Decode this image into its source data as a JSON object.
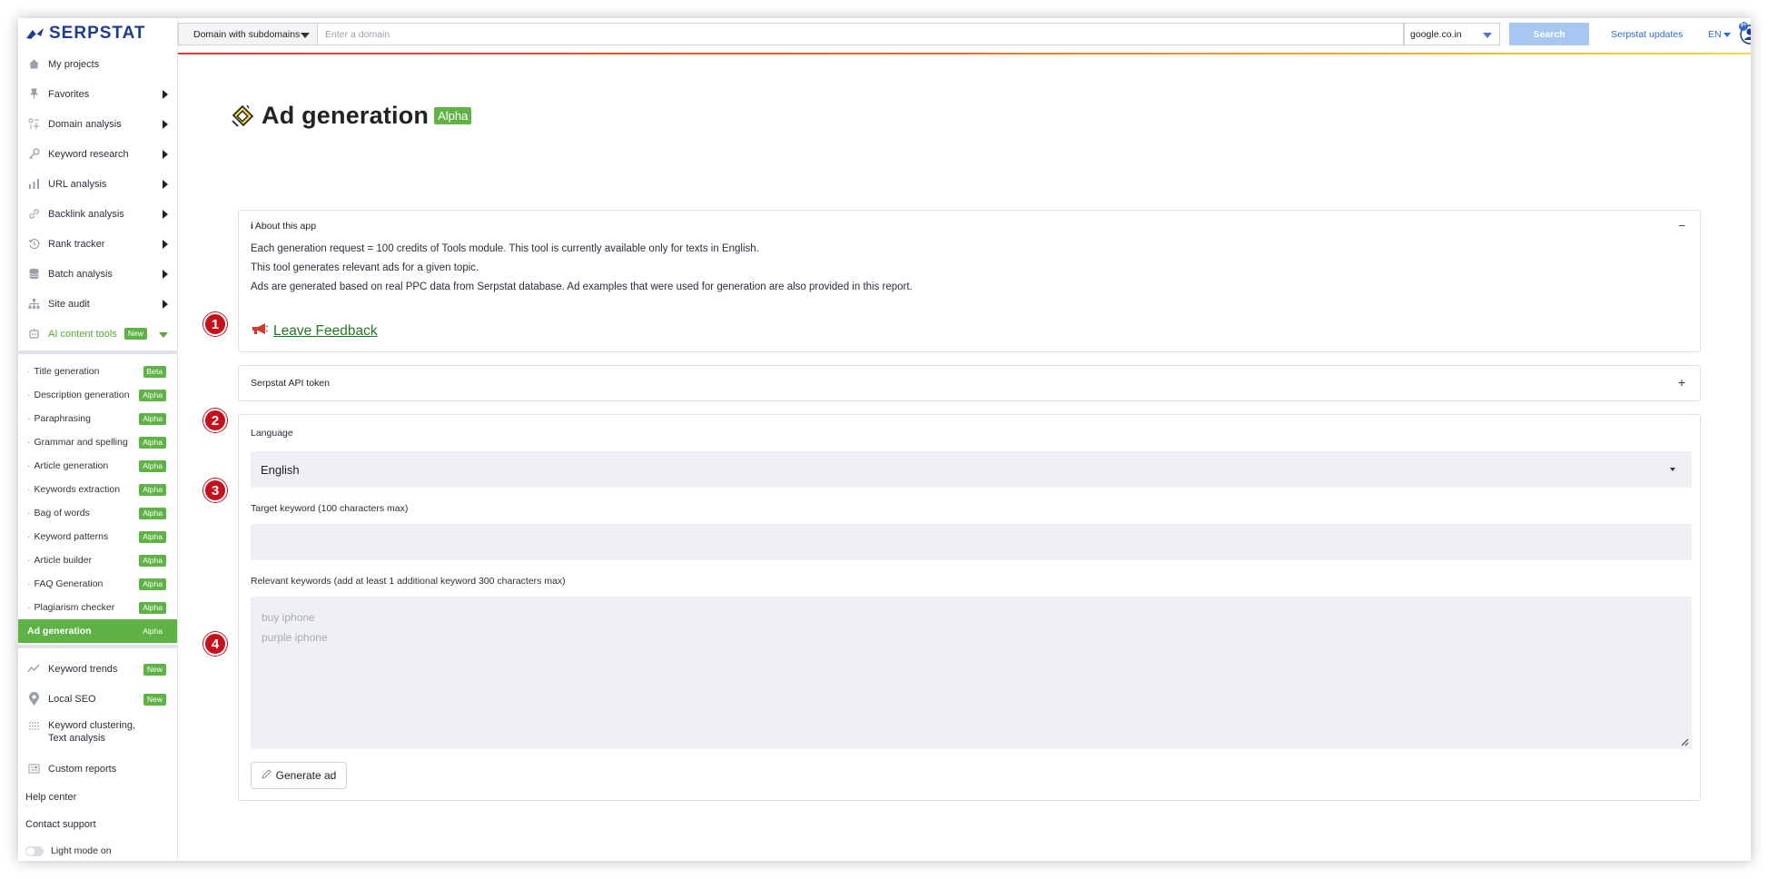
{
  "brand": {
    "name": "SERPSTAT",
    "color": "#1b3c8f",
    "accent_green": "#5fb246"
  },
  "sidebar": {
    "items": [
      {
        "label": "My projects",
        "icon": "home-icon",
        "expandable": false
      },
      {
        "label": "Favorites",
        "icon": "pin-icon",
        "expandable": true
      },
      {
        "label": "Domain analysis",
        "icon": "domain-icon",
        "expandable": true
      },
      {
        "label": "Keyword research",
        "icon": "key-icon",
        "expandable": true
      },
      {
        "label": "URL analysis",
        "icon": "bar-chart-icon",
        "expandable": true
      },
      {
        "label": "Backlink analysis",
        "icon": "link-icon",
        "expandable": true
      },
      {
        "label": "Rank tracker",
        "icon": "history-icon",
        "expandable": true
      },
      {
        "label": "Batch analysis",
        "icon": "database-icon",
        "expandable": true
      },
      {
        "label": "Site audit",
        "icon": "sitemap-icon",
        "expandable": true
      }
    ],
    "ai_tools": {
      "label": "AI content tools",
      "badge": "New",
      "icon": "robot-icon"
    },
    "ai_sub_items": [
      {
        "label": "Title generation",
        "badge": "Beta"
      },
      {
        "label": "Description generation",
        "badge": "Alpha"
      },
      {
        "label": "Paraphrasing",
        "badge": "Alpha"
      },
      {
        "label": "Grammar and spelling",
        "badge": "Alpha"
      },
      {
        "label": "Article generation",
        "badge": "Alpha"
      },
      {
        "label": "Keywords extraction",
        "badge": "Alpha"
      },
      {
        "label": "Bag of words",
        "badge": "Alpha"
      },
      {
        "label": "Keyword patterns",
        "badge": "Alpha"
      },
      {
        "label": "Article builder",
        "badge": "Alpha"
      },
      {
        "label": "FAQ Generation",
        "badge": "Alpha"
      },
      {
        "label": "Plagiarism checker",
        "badge": "Alpha"
      },
      {
        "label": "Ad generation",
        "badge": "Alpha",
        "active": true
      }
    ],
    "bottom_items": [
      {
        "label": "Keyword trends",
        "badge": "New",
        "icon": "trend-icon"
      },
      {
        "label": "Local SEO",
        "badge": "New",
        "icon": "location-pin-icon"
      },
      {
        "label": "Keyword clustering, Text analysis",
        "badge": "",
        "icon": "cluster-icon"
      },
      {
        "label": "Custom reports",
        "badge": "",
        "icon": "report-icon"
      }
    ],
    "help_center": "Help center",
    "contact_support": "Contact support",
    "light_mode": "Light mode on"
  },
  "topbar": {
    "domain_select": "Domain with subdomains",
    "domain_placeholder": "Enter a domain",
    "region": "google.co.in",
    "search_label": "Search",
    "updates_label": "Serpstat updates",
    "language": "EN",
    "avatar_badge": "9+"
  },
  "page": {
    "title": "Ad generation",
    "badge": "Alpha"
  },
  "about": {
    "header": "About this app",
    "lines": [
      "Each generation request = 100 credits of Tools module. This tool is currently available only for texts in English.",
      "This tool generates relevant ads for a given topic.",
      "Ads are generated based on real PPC data from Serpstat database. Ad examples that were used for generation are also provided in this report."
    ],
    "feedback_label": "Leave Feedback",
    "collapse_symbol": "−"
  },
  "token": {
    "header": "Serpstat API token",
    "expand_symbol": "+"
  },
  "form": {
    "language_label": "Language",
    "language_value": "English",
    "target_label": "Target keyword (100 characters max)",
    "relevant_label": "Relevant keywords (add at least 1 additional keyword 300 characters max)",
    "relevant_placeholder_lines": [
      "buy iphone",
      "purple iphone"
    ],
    "generate_label": "Generate ad"
  },
  "steps": [
    "1",
    "2",
    "3",
    "4"
  ]
}
